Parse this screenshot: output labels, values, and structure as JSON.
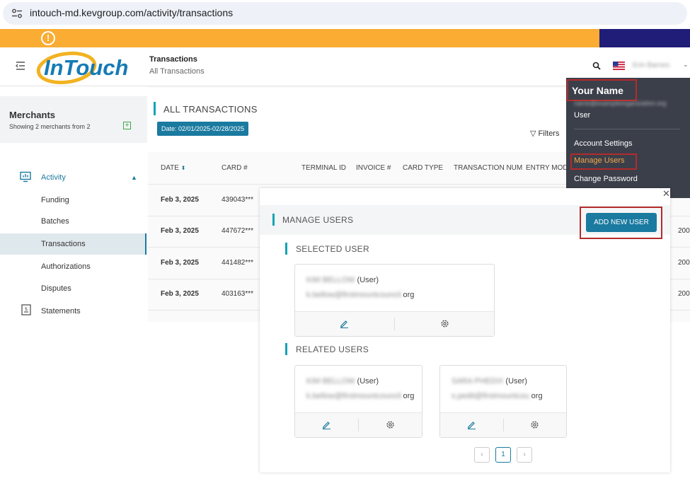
{
  "browser": {
    "url": "intouch-md.kevgroup.com/activity/transactions"
  },
  "banner": {
    "warning_glyph": "!"
  },
  "header": {
    "logo_text": "InTouch",
    "title": "Transactions",
    "subtitle": "All Transactions",
    "user_name_blurred": "Erin Barnes"
  },
  "sidebar": {
    "merchants_title": "Merchants",
    "merchants_sub": "Showing 2 merchants from 2",
    "add_glyph": "+",
    "items": [
      {
        "label": "Activity"
      },
      {
        "label": "Funding"
      },
      {
        "label": "Batches"
      },
      {
        "label": "Transactions"
      },
      {
        "label": "Authorizations"
      },
      {
        "label": "Disputes"
      },
      {
        "label": "Statements"
      }
    ]
  },
  "main": {
    "title": "ALL TRANSACTIONS",
    "date_chip": "Date: 02/01/2025-02/28/2025",
    "filters_label": "Filters",
    "columns": [
      "DATE",
      "CARD #",
      "TERMINAL ID",
      "INVOICE #",
      "CARD TYPE",
      "TRANSACTION NUM",
      "ENTRY MOD"
    ],
    "rows": [
      {
        "date": "Feb 3, 2025",
        "card": "439043***"
      },
      {
        "date": "Feb 3, 2025",
        "card": "447672***",
        "right": "200"
      },
      {
        "date": "Feb 3, 2025",
        "card": "441482***",
        "right": "200"
      },
      {
        "date": "Feb 3, 2025",
        "card": "403163***",
        "right": "200"
      }
    ]
  },
  "dropdown": {
    "name": "Your Name",
    "email_blurred": "name@exampleorganization.org",
    "items": [
      {
        "label": "User"
      },
      {
        "label": "Account Settings"
      },
      {
        "label": "Manage Users"
      },
      {
        "label": "Change Password"
      }
    ],
    "highlight_color": "#f6a84a"
  },
  "modal": {
    "title": "MANAGE USERS",
    "close_glyph": "✕",
    "add_button": "ADD NEW USER",
    "selected_title": "SELECTED USER",
    "related_title": "RELATED USERS",
    "selected_user": {
      "name_blurred": "KIM BELLOW",
      "role": " (User)",
      "email_blurred": "k.bellow@firstmountcouncil.",
      "email_suffix": "org"
    },
    "related_users": [
      {
        "name_blurred": "KIM BELLOW",
        "role": " (User)",
        "email_blurred": "k.bellow@firstmountcouncil.",
        "email_suffix": "org"
      },
      {
        "name_blurred": "SARA PHEDIX",
        "role": " (User)",
        "email_blurred": "s.pedit@firstmountcou.",
        "email_suffix": "org"
      }
    ],
    "pagination": {
      "prev": "‹",
      "current": "1",
      "next": "›"
    }
  },
  "colors": {
    "accent": "#1a7aa0",
    "teal_bar": "#14a3b4",
    "banner": "#fbac33",
    "dropdown_bg": "#3b3f4a",
    "annotation_red": "#b32b2b"
  }
}
